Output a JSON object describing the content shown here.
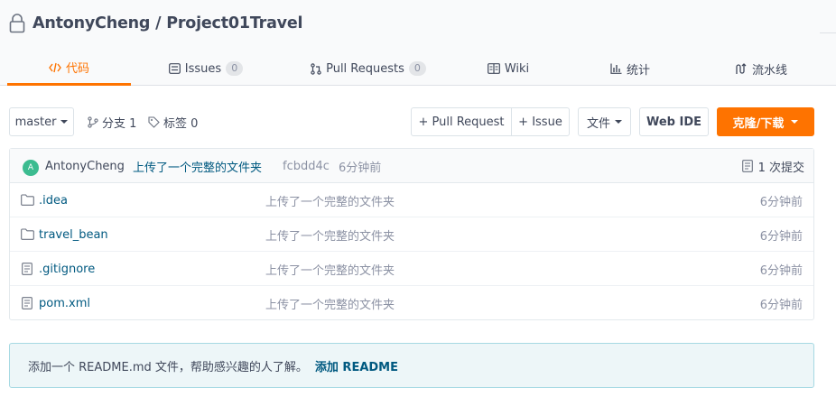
{
  "repo": {
    "owner": "AntonyCheng",
    "separator": "/",
    "name": "Project01Travel",
    "title": "AntonyCheng / Project01Travel"
  },
  "tabs": [
    {
      "label": "代码",
      "icon": "code-icon",
      "active": true
    },
    {
      "label": "Issues",
      "icon": "issues-icon",
      "count": "0"
    },
    {
      "label": "Pull Requests",
      "icon": "pull-request-icon",
      "count": "0"
    },
    {
      "label": "Wiki",
      "icon": "book-icon"
    },
    {
      "label": "统计",
      "icon": "bar-chart-icon"
    },
    {
      "label": "流水线",
      "icon": "pipeline-icon"
    }
  ],
  "toolbar": {
    "branch": "master",
    "branches_label": "分支 1",
    "tags_label": "标签 0",
    "pull_request_label": "+ Pull Request",
    "issue_label": "+ Issue",
    "file_label": "文件",
    "webide_label": "Web IDE",
    "clone_label": "克隆/下载"
  },
  "commit": {
    "avatar_letter": "A",
    "author": "AntonyCheng",
    "message": "上传了一个完整的文件夹",
    "hash": "fcbdd4c",
    "time": "6分钟前",
    "commits_label": "1 次提交"
  },
  "files": [
    {
      "name": ".idea",
      "type": "folder",
      "message": "上传了一个完整的文件夹",
      "time": "6分钟前"
    },
    {
      "name": "travel_bean",
      "type": "folder",
      "message": "上传了一个完整的文件夹",
      "time": "6分钟前"
    },
    {
      "name": ".gitignore",
      "type": "file",
      "message": "上传了一个完整的文件夹",
      "time": "6分钟前"
    },
    {
      "name": "pom.xml",
      "type": "file",
      "message": "上传了一个完整的文件夹",
      "time": "6分钟前"
    }
  ],
  "readme": {
    "text": "添加一个 README.md 文件，帮助感兴趣的人了解。",
    "link": "添加 README"
  },
  "colors": {
    "accent": "#fe7300",
    "link": "#005980",
    "muted": "#8c92a4",
    "avatar": "#3cbc90"
  }
}
